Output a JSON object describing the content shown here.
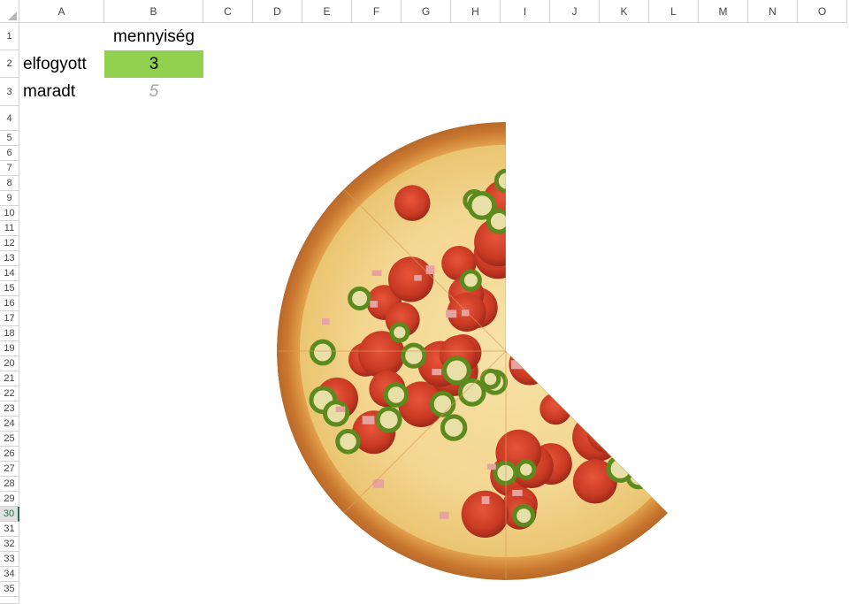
{
  "columns": [
    "A",
    "B",
    "C",
    "D",
    "E",
    "F",
    "G",
    "H",
    "I",
    "J",
    "K",
    "L",
    "M",
    "N",
    "O"
  ],
  "rows": [
    "1",
    "2",
    "3",
    "4",
    "5",
    "6",
    "7",
    "8",
    "9",
    "10",
    "11",
    "12",
    "13",
    "14",
    "15",
    "16",
    "17",
    "18",
    "19",
    "20",
    "21",
    "22",
    "23",
    "24",
    "25",
    "26",
    "27",
    "28",
    "29",
    "30",
    "31",
    "32",
    "33",
    "34",
    "35"
  ],
  "selected_row": "30",
  "cells": {
    "b1": "mennyiség",
    "a2": "elfogyott",
    "b2": "3",
    "a3": "maradt",
    "b3": "5"
  },
  "colors": {
    "highlight_fill": "#92d050",
    "muted_text": "#a6a6a6",
    "selection": "#217346"
  },
  "chart_data": {
    "type": "pie",
    "categories": [
      "elfogyott",
      "maradt"
    ],
    "values": [
      3,
      5
    ],
    "style": "pizza-textured slices; eaten slices removed"
  }
}
